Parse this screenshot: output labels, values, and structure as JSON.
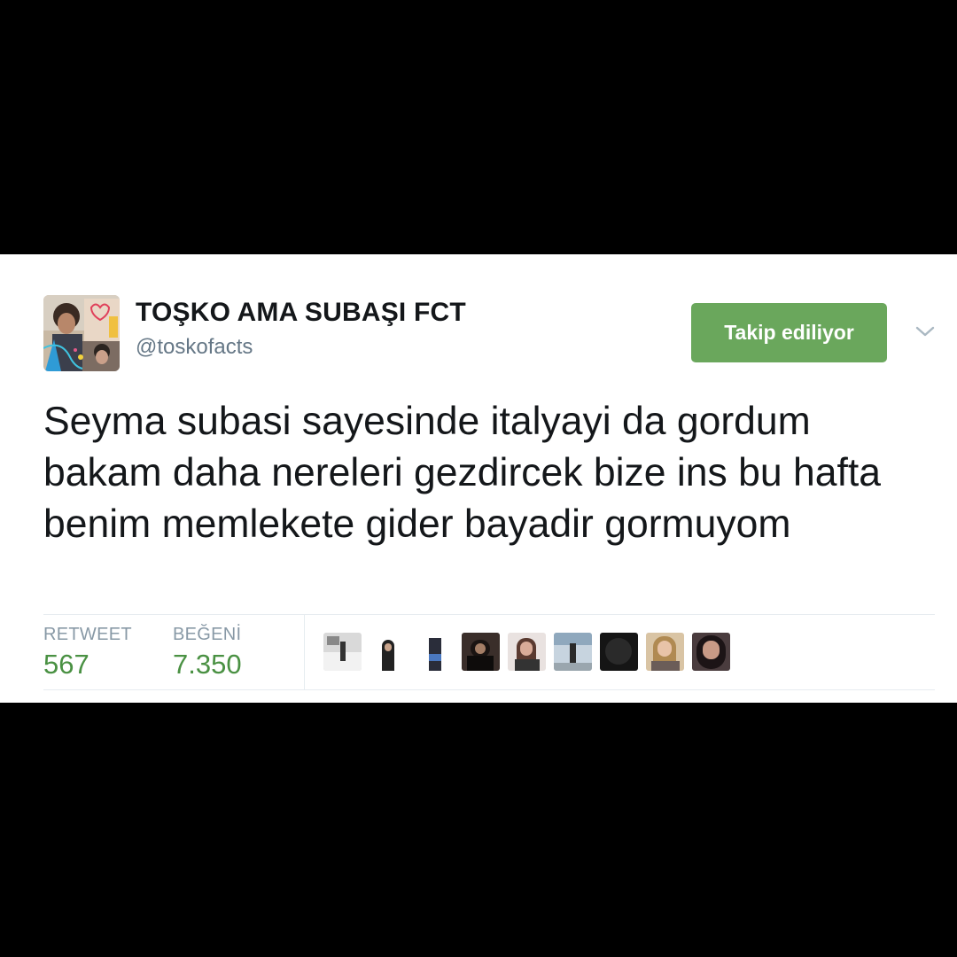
{
  "tweet": {
    "display_name": "TOŞKO AMA SUBAŞI FCT",
    "handle": "@toskofacts",
    "follow_button_label": "Takip ediliyor",
    "text": "Seyma subasi sayesinde italyayi da gordum bakam daha nereleri gezdircek bize ins bu hafta benim memlekete gider bayadir gormuyom",
    "retweet_label": "RETWEET",
    "retweet_count": "567",
    "like_label": "BEĞENİ",
    "like_count": "7.350"
  },
  "colors": {
    "follow_button": "#6aa75c",
    "stat_value": "#4a9143",
    "name": "#14171a",
    "handle": "#657786"
  },
  "icons": {
    "more_menu": "chevron-down-icon"
  },
  "likers": [
    {
      "name": "liker-avatar-1"
    },
    {
      "name": "liker-avatar-2"
    },
    {
      "name": "liker-avatar-3"
    },
    {
      "name": "liker-avatar-4"
    },
    {
      "name": "liker-avatar-5"
    },
    {
      "name": "liker-avatar-6"
    },
    {
      "name": "liker-avatar-7"
    },
    {
      "name": "liker-avatar-8"
    },
    {
      "name": "liker-avatar-9"
    }
  ]
}
